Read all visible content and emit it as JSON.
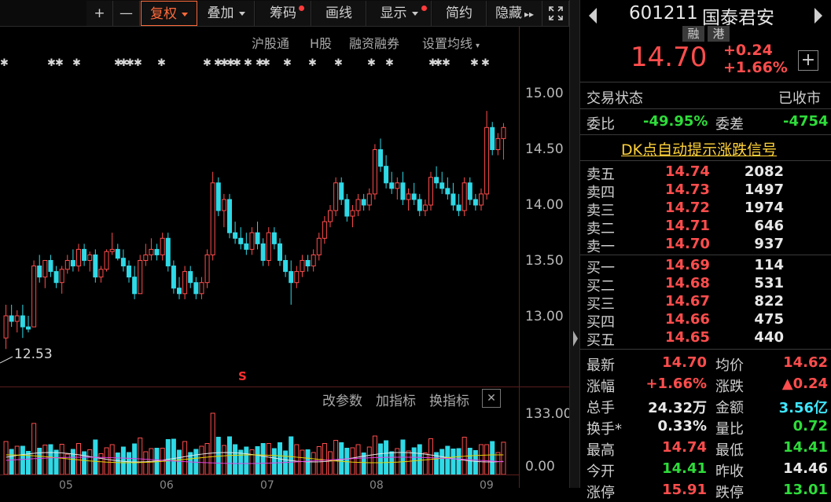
{
  "toolbar": {
    "plus": "+",
    "minus": "—",
    "fuquan": "复权",
    "diejia": "叠加",
    "chouma": "筹码",
    "huaxian": "画线",
    "xianshi": "显示",
    "jianyue": "简约",
    "yincang": "隐藏",
    "yincang_arrow": "▸▸"
  },
  "chart": {
    "sublinks": [
      "沪股通",
      "H股",
      "融资融券",
      "设置均线"
    ],
    "yaxis": [
      "15.00",
      "14.50",
      "14.00",
      "13.50",
      "13.00"
    ],
    "low_marker": "12.53",
    "signal_marker": "S",
    "indicator_bar": [
      "改参数",
      "加指标",
      "换指标"
    ],
    "close_x": "✕",
    "volume_axis": [
      "133.00",
      "0.00"
    ],
    "xaxis_partial": [
      "05",
      "06",
      "07",
      "08",
      "09"
    ]
  },
  "chart_data": {
    "type": "candlestick",
    "ylim": [
      12.5,
      15.1
    ],
    "up_color": "#ff4d4d",
    "down_color": "#2fd9e6",
    "candles": [
      [
        12.8,
        13.1,
        12.7,
        13.0
      ],
      [
        13.0,
        13.1,
        12.9,
        12.95
      ],
      [
        12.95,
        13.05,
        12.85,
        13.0
      ],
      [
        13.0,
        13.1,
        12.8,
        12.9
      ],
      [
        12.9,
        13.0,
        12.85,
        12.88
      ],
      [
        12.9,
        13.5,
        12.9,
        13.45
      ],
      [
        13.45,
        13.55,
        13.3,
        13.35
      ],
      [
        13.35,
        13.5,
        13.25,
        13.5
      ],
      [
        13.5,
        13.55,
        13.35,
        13.4
      ],
      [
        13.4,
        13.45,
        13.25,
        13.3
      ],
      [
        13.3,
        13.45,
        13.2,
        13.42
      ],
      [
        13.42,
        13.55,
        13.38,
        13.5
      ],
      [
        13.5,
        13.6,
        13.4,
        13.45
      ],
      [
        13.45,
        13.65,
        13.4,
        13.6
      ],
      [
        13.6,
        13.65,
        13.45,
        13.5
      ],
      [
        13.5,
        13.58,
        13.4,
        13.55
      ],
      [
        13.55,
        13.6,
        13.3,
        13.35
      ],
      [
        13.35,
        13.45,
        13.3,
        13.42
      ],
      [
        13.42,
        13.6,
        13.4,
        13.58
      ],
      [
        13.58,
        13.75,
        13.55,
        13.6
      ],
      [
        13.6,
        13.65,
        13.5,
        13.52
      ],
      [
        13.52,
        13.6,
        13.4,
        13.45
      ],
      [
        13.45,
        13.5,
        13.3,
        13.35
      ],
      [
        13.35,
        13.45,
        13.15,
        13.2
      ],
      [
        13.2,
        13.55,
        13.2,
        13.5
      ],
      [
        13.5,
        13.65,
        13.45,
        13.55
      ],
      [
        13.55,
        13.7,
        13.5,
        13.6
      ],
      [
        13.6,
        13.65,
        13.5,
        13.55
      ],
      [
        13.55,
        13.75,
        13.5,
        13.7
      ],
      [
        13.7,
        13.75,
        13.4,
        13.45
      ],
      [
        13.45,
        13.5,
        13.2,
        13.25
      ],
      [
        13.25,
        13.35,
        13.15,
        13.2
      ],
      [
        13.2,
        13.45,
        13.15,
        13.4
      ],
      [
        13.4,
        13.45,
        13.25,
        13.3
      ],
      [
        13.3,
        13.35,
        13.15,
        13.2
      ],
      [
        13.2,
        13.35,
        13.15,
        13.3
      ],
      [
        13.3,
        13.6,
        13.25,
        13.55
      ],
      [
        13.55,
        14.3,
        13.5,
        14.2
      ],
      [
        14.2,
        14.25,
        13.9,
        13.95
      ],
      [
        13.95,
        14.1,
        13.8,
        14.05
      ],
      [
        14.05,
        14.1,
        13.7,
        13.75
      ],
      [
        13.75,
        13.85,
        13.65,
        13.7
      ],
      [
        13.7,
        13.8,
        13.6,
        13.65
      ],
      [
        13.65,
        13.75,
        13.55,
        13.6
      ],
      [
        13.6,
        13.8,
        13.55,
        13.75
      ],
      [
        13.75,
        13.85,
        13.6,
        13.65
      ],
      [
        13.65,
        13.7,
        13.45,
        13.5
      ],
      [
        13.5,
        13.8,
        13.45,
        13.75
      ],
      [
        13.75,
        13.8,
        13.6,
        13.65
      ],
      [
        13.65,
        13.7,
        13.45,
        13.5
      ],
      [
        13.5,
        13.55,
        13.35,
        13.4
      ],
      [
        13.4,
        13.5,
        13.1,
        13.3
      ],
      [
        13.3,
        13.45,
        13.25,
        13.4
      ],
      [
        13.4,
        13.55,
        13.35,
        13.5
      ],
      [
        13.5,
        13.55,
        13.4,
        13.45
      ],
      [
        13.45,
        13.6,
        13.4,
        13.55
      ],
      [
        13.55,
        13.75,
        13.5,
        13.7
      ],
      [
        13.7,
        13.9,
        13.65,
        13.85
      ],
      [
        13.85,
        14.0,
        13.8,
        13.95
      ],
      [
        13.95,
        14.25,
        13.9,
        14.2
      ],
      [
        14.2,
        14.25,
        14.0,
        14.05
      ],
      [
        14.05,
        14.1,
        13.85,
        13.9
      ],
      [
        13.9,
        14.0,
        13.8,
        13.95
      ],
      [
        13.95,
        14.1,
        13.9,
        14.05
      ],
      [
        14.05,
        14.1,
        13.95,
        14.0
      ],
      [
        14.0,
        14.15,
        13.95,
        14.1
      ],
      [
        14.1,
        14.55,
        14.05,
        14.5
      ],
      [
        14.5,
        14.6,
        14.3,
        14.35
      ],
      [
        14.35,
        14.45,
        14.15,
        14.2
      ],
      [
        14.2,
        14.3,
        14.1,
        14.15
      ],
      [
        14.15,
        14.25,
        14.05,
        14.2
      ],
      [
        14.2,
        14.3,
        14.0,
        14.05
      ],
      [
        14.05,
        14.15,
        13.95,
        14.1
      ],
      [
        14.1,
        14.2,
        14.0,
        14.05
      ],
      [
        14.05,
        14.1,
        13.9,
        13.95
      ],
      [
        13.95,
        14.05,
        13.9,
        14.0
      ],
      [
        14.0,
        14.3,
        13.95,
        14.25
      ],
      [
        14.25,
        14.35,
        14.15,
        14.2
      ],
      [
        14.2,
        14.3,
        14.1,
        14.15
      ],
      [
        14.15,
        14.25,
        14.05,
        14.1
      ],
      [
        14.1,
        14.2,
        13.95,
        14.0
      ],
      [
        14.0,
        14.1,
        13.9,
        13.95
      ],
      [
        13.95,
        14.25,
        13.9,
        14.2
      ],
      [
        14.2,
        14.25,
        14.0,
        14.05
      ],
      [
        14.05,
        14.1,
        13.95,
        14.0
      ],
      [
        14.0,
        14.15,
        13.95,
        14.1
      ],
      [
        14.1,
        14.85,
        14.05,
        14.7
      ],
      [
        14.7,
        14.75,
        14.45,
        14.5
      ],
      [
        14.5,
        14.65,
        14.45,
        14.6
      ],
      [
        14.6,
        14.74,
        14.41,
        14.7
      ]
    ]
  },
  "panel": {
    "code": "601211",
    "name": "国泰君安",
    "tag_rong": "融",
    "tag_gang": "港",
    "price": "14.70",
    "change": "+0.24",
    "change_pct": "+1.66%",
    "plus_btn": "+",
    "status_label": "交易状态",
    "status_value": "已收市",
    "weibi_label": "委比",
    "weibi_value": "-49.95%",
    "weicha_label": "委差",
    "weicha_value": "-4754",
    "dk_signal": "DK点自动提示涨跌信号",
    "asks": [
      {
        "label": "卖五",
        "price": "14.74",
        "vol": "2082"
      },
      {
        "label": "卖四",
        "price": "14.73",
        "vol": "1497"
      },
      {
        "label": "卖三",
        "price": "14.72",
        "vol": "1974"
      },
      {
        "label": "卖二",
        "price": "14.71",
        "vol": "646"
      },
      {
        "label": "卖一",
        "price": "14.70",
        "vol": "937"
      }
    ],
    "bids": [
      {
        "label": "买一",
        "price": "14.69",
        "vol": "114"
      },
      {
        "label": "买二",
        "price": "14.68",
        "vol": "531"
      },
      {
        "label": "买三",
        "price": "14.67",
        "vol": "822"
      },
      {
        "label": "买四",
        "price": "14.66",
        "vol": "475"
      },
      {
        "label": "买五",
        "price": "14.65",
        "vol": "440"
      }
    ],
    "stats": [
      {
        "l1": "最新",
        "v1": "14.70",
        "c1": "red",
        "l2": "均价",
        "v2": "14.62",
        "c2": "red"
      },
      {
        "l1": "涨幅",
        "v1": "+1.66%",
        "c1": "red",
        "l2": "涨跌",
        "v2": "▲0.24",
        "c2": "red"
      },
      {
        "l1": "总手",
        "v1": "24.32万",
        "c1": "white",
        "l2": "金额",
        "v2": "3.56亿",
        "c2": "cyan"
      },
      {
        "l1": "换手*",
        "v1": "0.33%",
        "c1": "white",
        "l2": "量比",
        "v2": "0.72",
        "c2": "green"
      },
      {
        "l1": "最高",
        "v1": "14.74",
        "c1": "red",
        "l2": "最低",
        "v2": "14.41",
        "c2": "green"
      },
      {
        "l1": "今开",
        "v1": "14.41",
        "c1": "green",
        "l2": "昨收",
        "v2": "14.46",
        "c2": "white"
      },
      {
        "l1": "涨停",
        "v1": "15.91",
        "c1": "red",
        "l2": "跌停",
        "v2": "13.01",
        "c2": "green"
      }
    ]
  }
}
